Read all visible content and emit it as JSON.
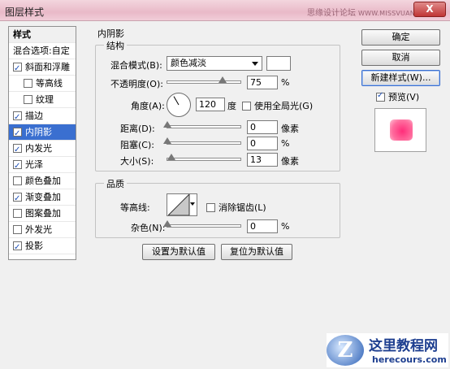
{
  "window": {
    "title": "图层样式",
    "close_label": "X"
  },
  "watermark": {
    "site": "思缘设计论坛",
    "url": "WWW.MISSVUAN.COM"
  },
  "styles_list": {
    "header": "样式",
    "blend_item": "混合选项:自定",
    "items": [
      {
        "label": "斜面和浮雕",
        "checked": true
      },
      {
        "label": "等高线",
        "checked": false
      },
      {
        "label": "纹理",
        "checked": false
      },
      {
        "label": "描边",
        "checked": true
      },
      {
        "label": "内阴影",
        "checked": true,
        "selected": true
      },
      {
        "label": "内发光",
        "checked": true
      },
      {
        "label": "光泽",
        "checked": true
      },
      {
        "label": "颜色叠加",
        "checked": false
      },
      {
        "label": "渐变叠加",
        "checked": true
      },
      {
        "label": "图案叠加",
        "checked": false
      },
      {
        "label": "外发光",
        "checked": false
      },
      {
        "label": "投影",
        "checked": true
      }
    ]
  },
  "inner_shadow": {
    "section_title": "内阴影",
    "structure": {
      "group_title": "结构",
      "blend_mode_label": "混合模式(B):",
      "blend_mode_value": "颜色减淡",
      "blend_color": "#ffffff",
      "opacity_label": "不透明度(O):",
      "opacity_value": "75",
      "opacity_unit": "%",
      "opacity_fraction": 0.75,
      "angle_label": "角度(A):",
      "angle_value": "120",
      "angle_unit": "度",
      "angle_degrees": 120,
      "global_light_label": "使用全局光(G)",
      "global_light_checked": false,
      "distance_label": "距离(D):",
      "distance_value": "0",
      "distance_unit": "像素",
      "distance_fraction": 0.0,
      "choke_label": "阻塞(C):",
      "choke_value": "0",
      "choke_unit": "%",
      "choke_fraction": 0.0,
      "size_label": "大小(S):",
      "size_value": "13",
      "size_unit": "像素",
      "size_fraction": 0.05
    },
    "quality": {
      "group_title": "品质",
      "contour_label": "等高线:",
      "anti_alias_label": "消除锯齿(L)",
      "anti_alias_checked": false,
      "noise_label": "杂色(N):",
      "noise_value": "0",
      "noise_unit": "%",
      "noise_fraction": 0.0
    },
    "set_default_label": "设置为默认值",
    "reset_default_label": "复位为默认值"
  },
  "actions": {
    "ok_label": "确定",
    "cancel_label": "取消",
    "new_style_label": "新建样式(W)...",
    "preview_label": "预览(V)",
    "preview_checked": true
  },
  "logo": {
    "title": "这里教程网",
    "url": "herecours.com",
    "badge": "Z"
  },
  "colors": {
    "accent": "#3a6fd0",
    "titlebar": "#e9b9c8",
    "preview": "#ff2d7a"
  }
}
